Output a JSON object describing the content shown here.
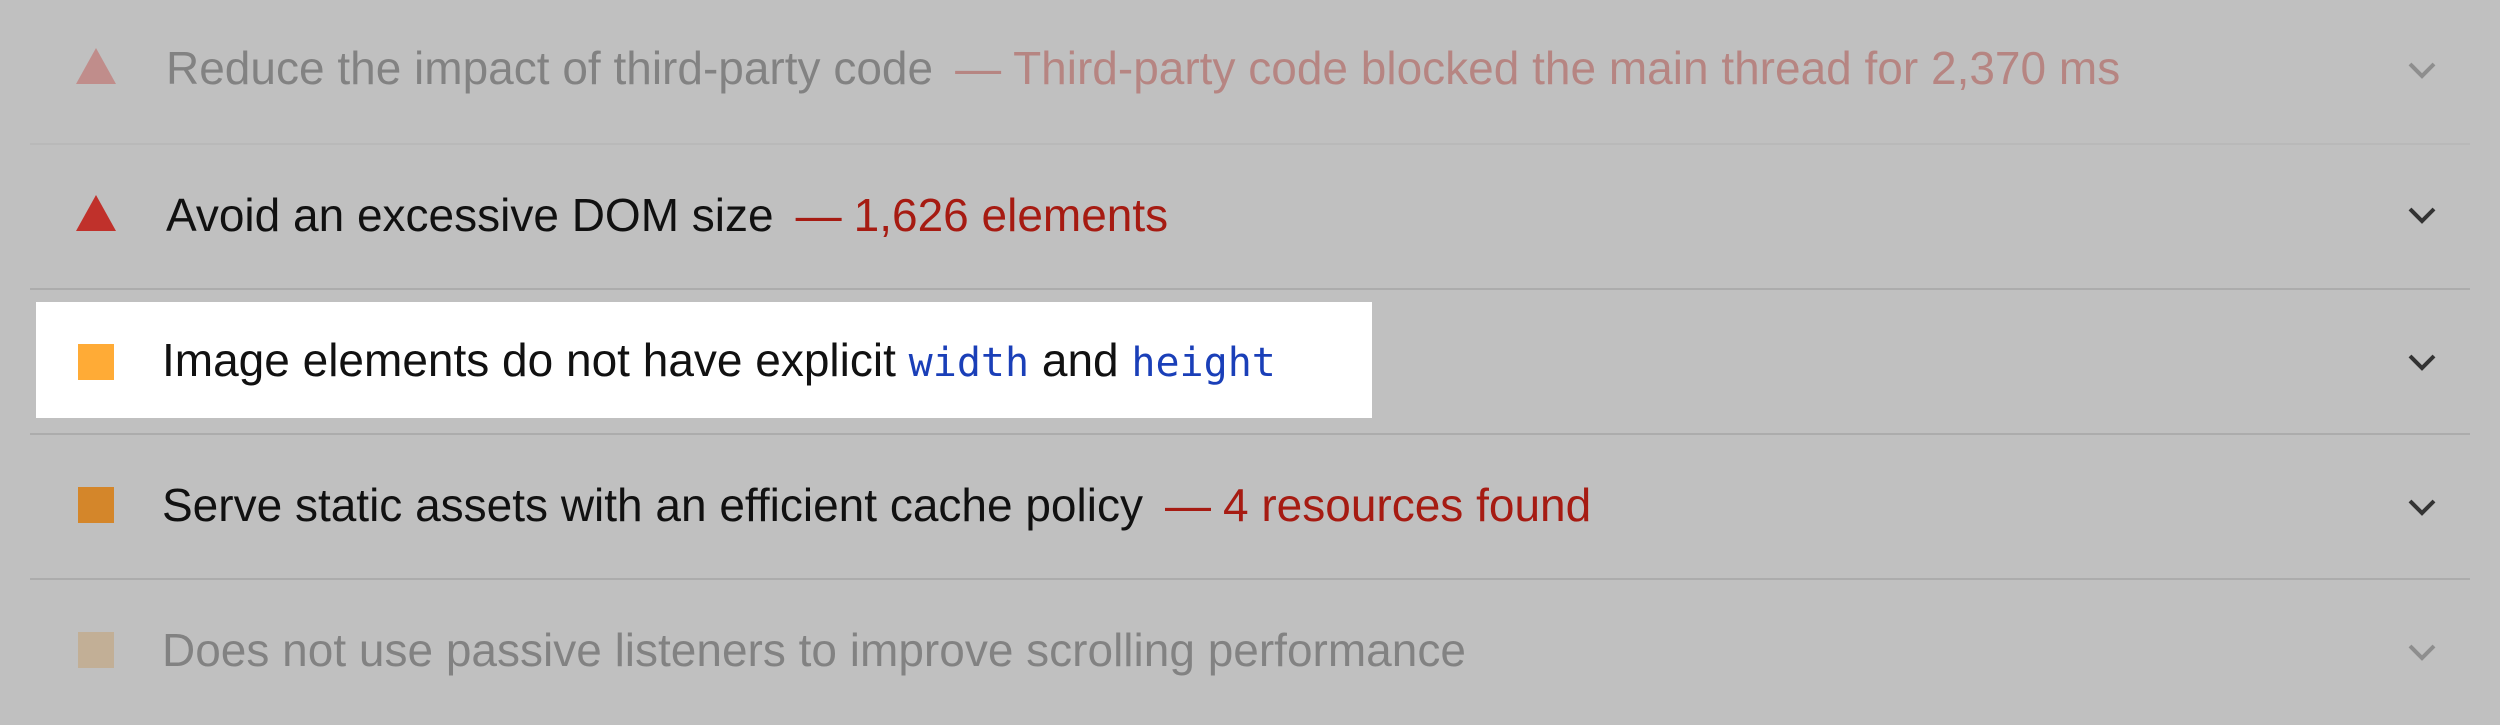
{
  "audits": [
    {
      "title": "Reduce the impact of third-party code",
      "separator": "—",
      "display_value": "Third-party code blocked the main thread for 2,370 ms",
      "icon": "triangle-fail-icon",
      "icon_color": "#c0312b"
    },
    {
      "title": "Avoid an excessive DOM size",
      "separator": "—",
      "display_value": "1,626 elements",
      "icon": "triangle-fail-icon",
      "icon_color": "#c0312b"
    },
    {
      "title_prefix": "Image elements do not have explicit",
      "code1": "width",
      "and": "and",
      "code2": "height",
      "icon": "square-average-icon",
      "icon_color": "#ffab36"
    },
    {
      "title": "Serve static assets with an efficient cache policy",
      "separator": "—",
      "display_value": "4 resources found",
      "icon": "square-average-icon",
      "icon_color": "#d4862a"
    },
    {
      "title": "Does not use passive listeners to improve scrolling performance",
      "icon": "square-average-icon",
      "icon_color": "#d9c9ad"
    }
  ],
  "colors": {
    "background": "#c0c0c0",
    "fail": "#a61b12",
    "code": "#1a3fb8",
    "highlight": "#ffffff"
  }
}
